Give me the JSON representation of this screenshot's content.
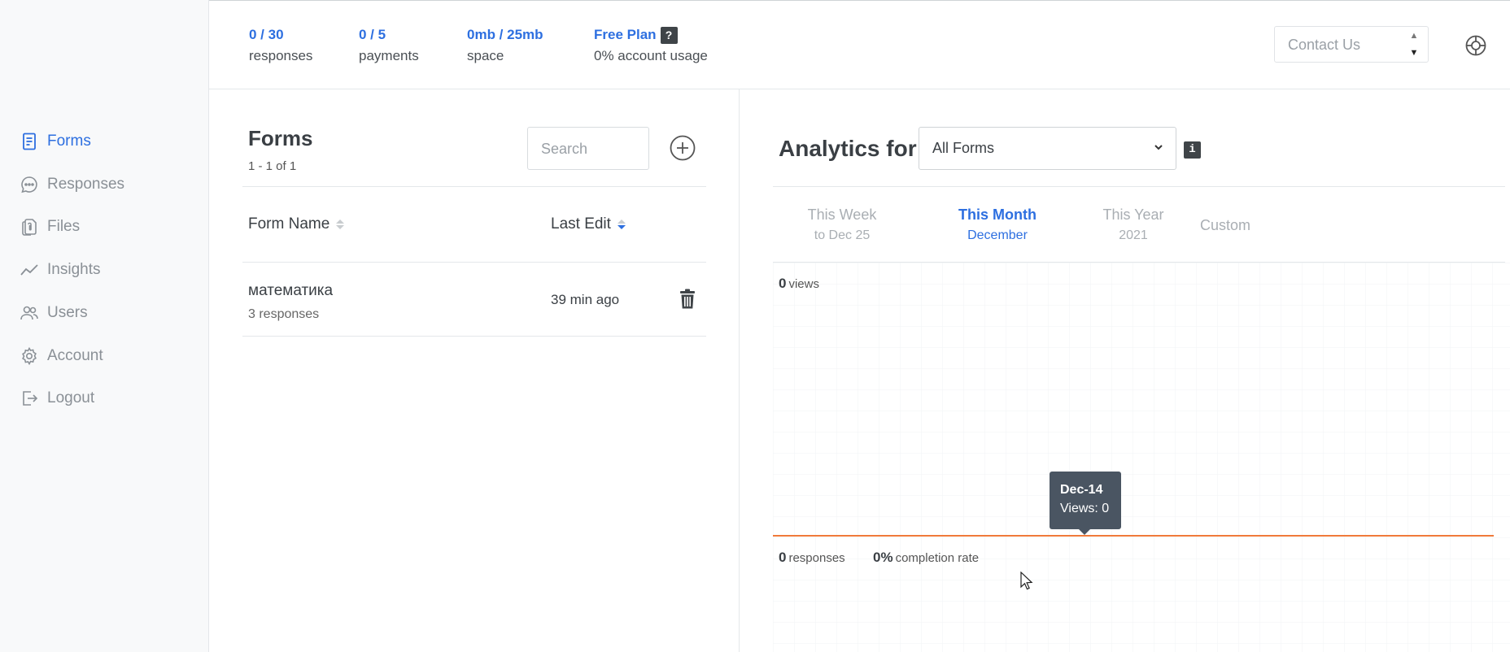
{
  "sidebar": {
    "items": [
      {
        "label": "Forms",
        "icon": "form-icon",
        "active": true
      },
      {
        "label": "Responses",
        "icon": "chat-bubble-icon",
        "active": false
      },
      {
        "label": "Files",
        "icon": "files-icon",
        "active": false
      },
      {
        "label": "Insights",
        "icon": "trend-line-icon",
        "active": false
      },
      {
        "label": "Users",
        "icon": "users-icon",
        "active": false
      },
      {
        "label": "Account",
        "icon": "gear-icon",
        "active": false
      },
      {
        "label": "Logout",
        "icon": "logout-icon",
        "active": false
      }
    ]
  },
  "stats": {
    "responses": {
      "value": "0 / 30",
      "label": "responses"
    },
    "payments": {
      "value": "0 / 5",
      "label": "payments"
    },
    "space": {
      "value": "0mb / 25mb",
      "label": "space"
    },
    "plan": {
      "value": "Free Plan",
      "badge": "?",
      "label": "0% account usage"
    }
  },
  "header": {
    "contact_placeholder": "Contact Us"
  },
  "forms": {
    "title": "Forms",
    "count": "1 - 1 of 1",
    "search_placeholder": "Search",
    "columns": {
      "name": "Form Name",
      "last_edit": "Last Edit"
    },
    "rows": [
      {
        "name": "математика",
        "responses": "3 responses",
        "last_edit": "39 min ago"
      }
    ]
  },
  "analytics": {
    "title": "Analytics for",
    "selected_form": "All Forms",
    "info_badge": "i",
    "tabs": [
      {
        "label": "This Week",
        "sub": "to Dec 25",
        "active": false
      },
      {
        "label": "This Month",
        "sub": "December",
        "active": true
      },
      {
        "label": "This Year",
        "sub": "2021",
        "active": false
      },
      {
        "label": "Custom",
        "sub": "",
        "active": false
      }
    ],
    "views": {
      "value": "0",
      "label": "views"
    },
    "responses": {
      "value": "0",
      "label": "responses"
    },
    "completion": {
      "value": "0%",
      "label": "completion rate"
    },
    "tooltip": {
      "date": "Dec-14",
      "text": "Views: 0"
    }
  },
  "colors": {
    "accent": "#2d6fe0",
    "line": "#f07a3a",
    "tooltip_bg": "#4a5562"
  }
}
